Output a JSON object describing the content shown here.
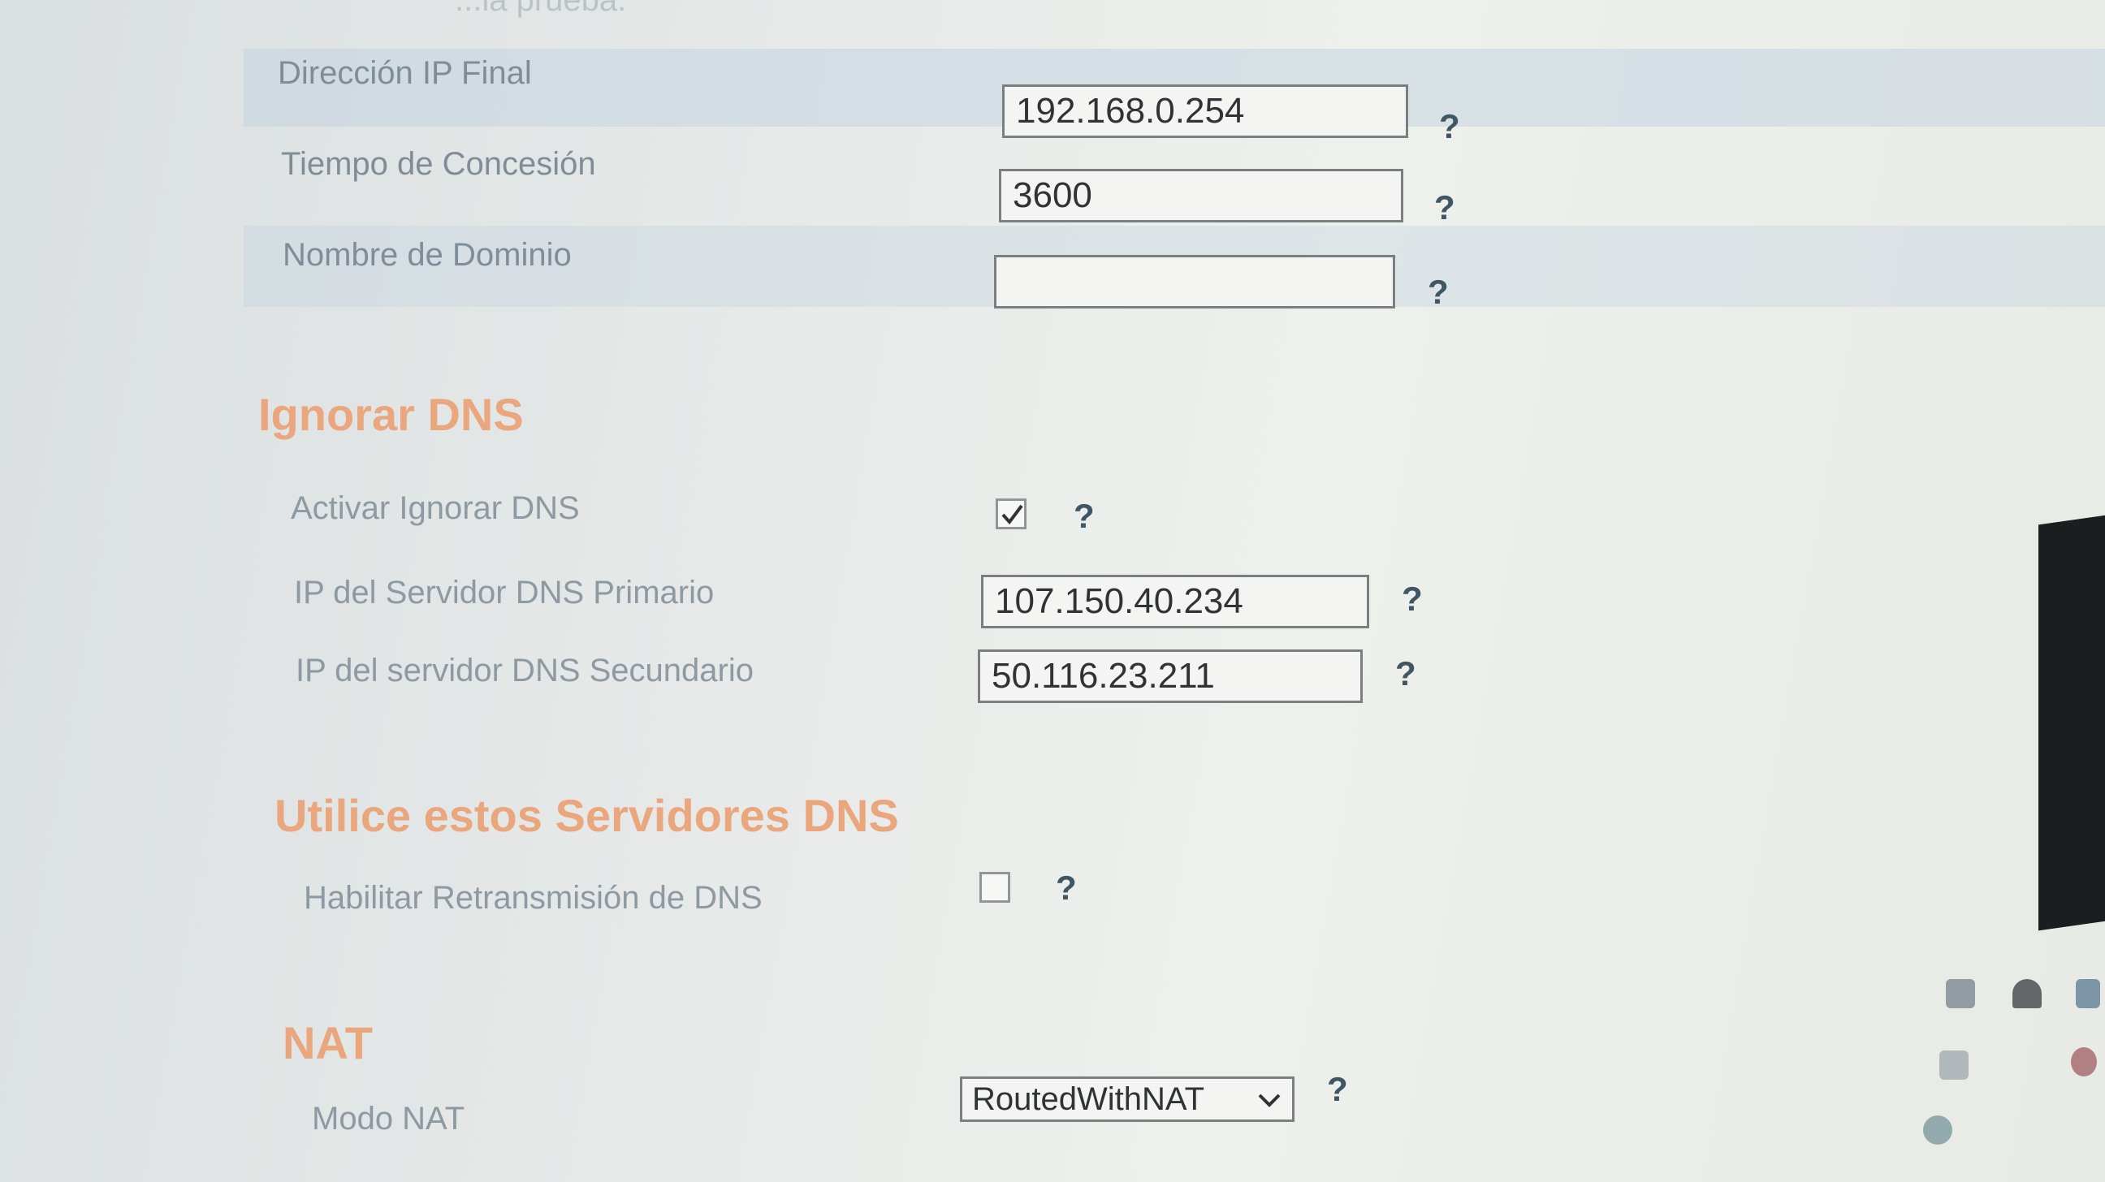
{
  "header": {
    "partial_text": "...la prueba."
  },
  "dhcp": {
    "rows": [
      {
        "label": "Dirección IP Final",
        "value": "192.168.0.254",
        "help": "?"
      },
      {
        "label": "Tiempo de Concesión",
        "value": "3600",
        "help": "?"
      },
      {
        "label": "Nombre de Dominio",
        "value": "",
        "help": "?"
      }
    ]
  },
  "ignore_dns": {
    "title": "Ignorar DNS",
    "enable_label": "Activar Ignorar DNS",
    "enable_checked": true,
    "enable_help": "?",
    "primary_label": "IP del Servidor DNS Primario",
    "primary_value": "107.150.40.234",
    "primary_help": "?",
    "secondary_label": "IP del servidor DNS Secundario",
    "secondary_value": "50.116.23.211",
    "secondary_help": "?"
  },
  "use_dns": {
    "title": "Utilice estos Servidores DNS",
    "relay_label": "Habilitar Retransmisión de DNS",
    "relay_checked": false,
    "relay_help": "?"
  },
  "nat": {
    "title": "NAT",
    "mode_label": "Modo NAT",
    "mode_value": "RoutedWithNAT",
    "mode_help": "?"
  },
  "colors": {
    "section_title": "#eaa67d",
    "label": "#8d9aa3",
    "help": "#3f5664"
  },
  "tray_icons": [
    "monitor-icon",
    "network-icon",
    "speaker-icon",
    "app-icon"
  ]
}
